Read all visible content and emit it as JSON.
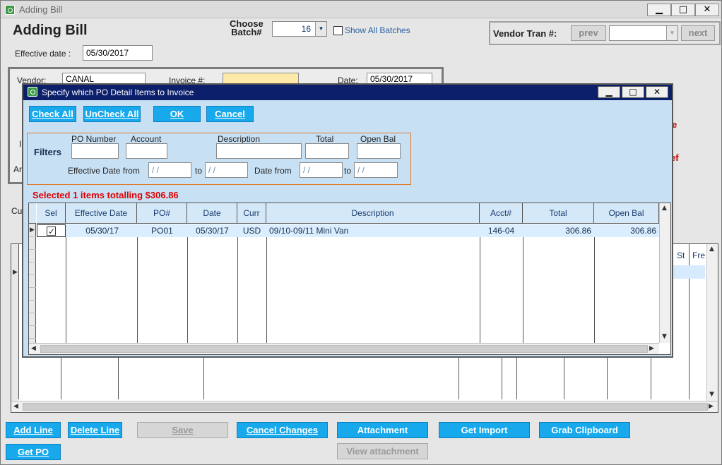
{
  "window": {
    "title": "Adding Bill",
    "minimize": "▁",
    "maximize": "□",
    "close": "✕"
  },
  "header": {
    "heading": "Adding Bill",
    "batch_label": "Choose\nBatch#",
    "batch_value": "16",
    "show_all_batches": "Show All Batches",
    "vendor_tran_label": "Vendor Tran #:",
    "prev": "prev",
    "next": "next",
    "effective_label": "Effective date :",
    "effective_value": "05/30/2017"
  },
  "form": {
    "vendor_label": "Vendor:",
    "vendor_value": "CANAL",
    "invoice_label": "Invoice #:",
    "date_label": "Date:",
    "date_value": "05/30/2017",
    "cu_label": "Cu",
    "ar_label": "Ar",
    "i_label": "I",
    "red_e": "e",
    "red_ef": "ef"
  },
  "background_grid": {
    "col_st": "St",
    "col_fre": "Fre"
  },
  "dialog": {
    "title": "Specify which PO Detail Items to Invoice",
    "buttons": {
      "check_all": "Check All",
      "uncheck_all": "UnCheck All",
      "ok": "OK",
      "cancel": "Cancel"
    },
    "filters": {
      "label": "Filters",
      "po_number": "PO Number",
      "account": "Account",
      "description": "Description",
      "total": "Total",
      "open_bal": "Open Bal",
      "eff_from": "Effective Date from",
      "to": "to",
      "date_from": "Date from",
      "date_placeholder": " /  /"
    },
    "selected_summary": "Selected 1 items totalling $306.86",
    "columns": [
      "Sel",
      "Effective Date",
      "PO#",
      "Date",
      "Curr",
      "Description",
      "Acct#",
      "Total",
      "Open Bal"
    ],
    "rows": [
      {
        "sel": true,
        "effective_date": "05/30/17",
        "po": "PO01",
        "date": "05/30/17",
        "curr": "USD",
        "description": "09/10-09/11 Mini Van",
        "acct": "146-04",
        "total": "306.86",
        "open_bal": "306.86"
      }
    ]
  },
  "bottom_buttons": {
    "add_line": "Add Line",
    "delete_line": "Delete Line",
    "save": "Save",
    "cancel_changes": "Cancel Changes",
    "attachment": "Attachment",
    "get_import": "Get Import",
    "grab_clipboard": "Grab Clipboard",
    "get_po": "Get PO",
    "view_attachment": "View attachment"
  },
  "colors": {
    "accent": "#17a9ec",
    "dialog_title": "#0b1f6b",
    "dialog_bg": "#c8e0f4",
    "alert": "#e00000"
  },
  "icons": [
    "app-icon",
    "minimize-icon",
    "maximize-icon",
    "close-icon",
    "dropdown-arrow-icon",
    "row-pointer-icon",
    "scroll-arrow-icon"
  ]
}
